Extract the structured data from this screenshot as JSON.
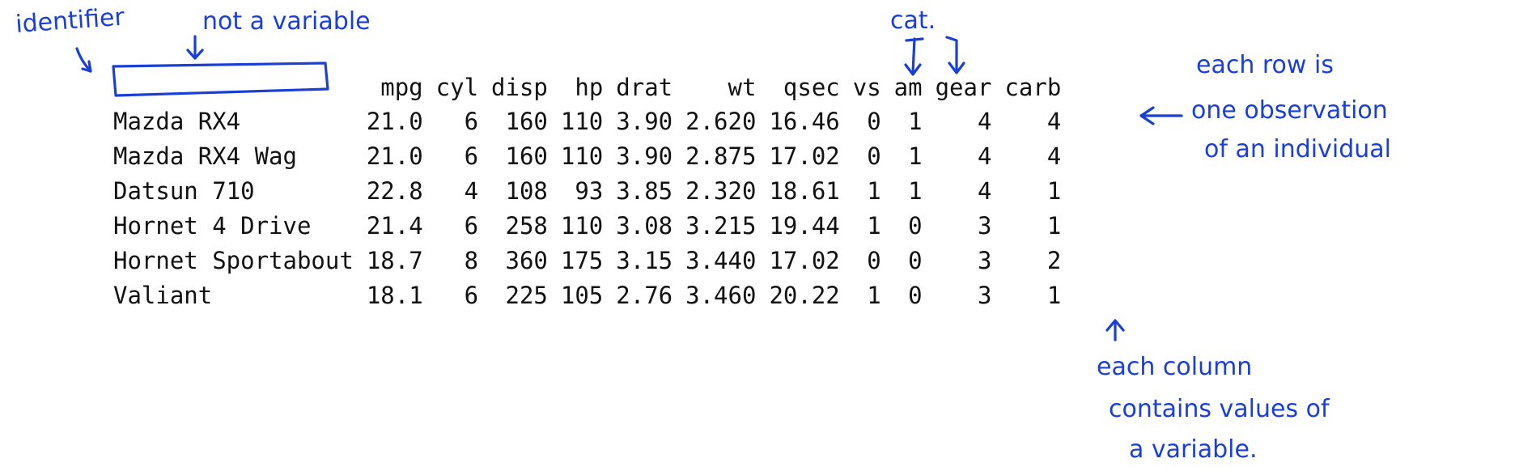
{
  "annotations": {
    "identifier": "identifier",
    "not_a_variable": "not a variable",
    "cat": "cat.",
    "row_note": [
      "each row is",
      "one observation",
      "of an individual"
    ],
    "column_note": [
      "each column",
      "contains values of",
      "a variable."
    ]
  },
  "table": {
    "headers": [
      "",
      "mpg",
      "cyl",
      "disp",
      "hp",
      "drat",
      "wt",
      "qsec",
      "vs",
      "am",
      "gear",
      "carb"
    ],
    "rows": [
      [
        "Mazda RX4",
        "21.0",
        "6",
        "160",
        "110",
        "3.90",
        "2.620",
        "16.46",
        "0",
        "1",
        "4",
        "4"
      ],
      [
        "Mazda RX4 Wag",
        "21.0",
        "6",
        "160",
        "110",
        "3.90",
        "2.875",
        "17.02",
        "0",
        "1",
        "4",
        "4"
      ],
      [
        "Datsun 710",
        "22.8",
        "4",
        "108",
        "93",
        "3.85",
        "2.320",
        "18.61",
        "1",
        "1",
        "4",
        "1"
      ],
      [
        "Hornet 4 Drive",
        "21.4",
        "6",
        "258",
        "110",
        "3.08",
        "3.215",
        "19.44",
        "1",
        "0",
        "3",
        "1"
      ],
      [
        "Hornet Sportabout",
        "18.7",
        "8",
        "360",
        "175",
        "3.15",
        "3.440",
        "17.02",
        "0",
        "0",
        "3",
        "2"
      ],
      [
        "Valiant",
        "18.1",
        "6",
        "225",
        "105",
        "2.76",
        "3.460",
        "20.22",
        "1",
        "0",
        "3",
        "1"
      ]
    ]
  },
  "colors": {
    "ink": "#1a3fd6",
    "text": "#111111"
  }
}
